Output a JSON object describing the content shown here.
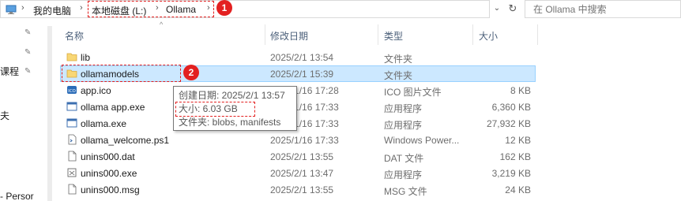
{
  "address_bar": {
    "crumbs": [
      "我的电脑",
      "本地磁盘 (L:)",
      "Ollama"
    ],
    "search_placeholder": "在 Ollama 中搜索"
  },
  "nav": {
    "fragments": [
      "课程",
      "夫",
      "- Persor"
    ]
  },
  "columns": {
    "name": "名称",
    "date": "修改日期",
    "type": "类型",
    "size": "大小"
  },
  "files": [
    {
      "name": "lib",
      "date": "2025/2/1 13:54",
      "type": "文件夹",
      "size": "",
      "icon": "folder-icon"
    },
    {
      "name": "ollamamodels",
      "date": "2025/2/1 15:39",
      "type": "文件夹",
      "size": "",
      "icon": "folder-icon"
    },
    {
      "name": "app.ico",
      "date": "2025/1/16 17:28",
      "type": "ICO 图片文件",
      "size": "8 KB",
      "icon": "ico-file-icon"
    },
    {
      "name": "ollama app.exe",
      "date": "2025/1/16 17:33",
      "type": "应用程序",
      "size": "6,360 KB",
      "icon": "app-window-icon"
    },
    {
      "name": "ollama.exe",
      "date": "2025/1/16 17:33",
      "type": "应用程序",
      "size": "27,932 KB",
      "icon": "app-window-icon"
    },
    {
      "name": "ollama_welcome.ps1",
      "date": "2025/1/16 17:33",
      "type": "Windows Power...",
      "size": "12 KB",
      "icon": "powershell-icon"
    },
    {
      "name": "unins000.dat",
      "date": "2025/2/1 13:55",
      "type": "DAT 文件",
      "size": "162 KB",
      "icon": "document-icon"
    },
    {
      "name": "unins000.exe",
      "date": "2025/2/1 13:47",
      "type": "应用程序",
      "size": "3,219 KB",
      "icon": "uninstaller-icon"
    },
    {
      "name": "unins000.msg",
      "date": "2025/2/1 13:55",
      "type": "MSG 文件",
      "size": "24 KB",
      "icon": "document-icon"
    }
  ],
  "tooltip": {
    "created": "创建日期: 2025/2/1 13:57",
    "size": "大小: 6.03 GB",
    "contents": "文件夹: blobs, manifests"
  },
  "badges": [
    "1",
    "2"
  ],
  "colors": {
    "selection": "#cce8ff",
    "annotation": "#e32020",
    "folder": "#f8d775"
  }
}
